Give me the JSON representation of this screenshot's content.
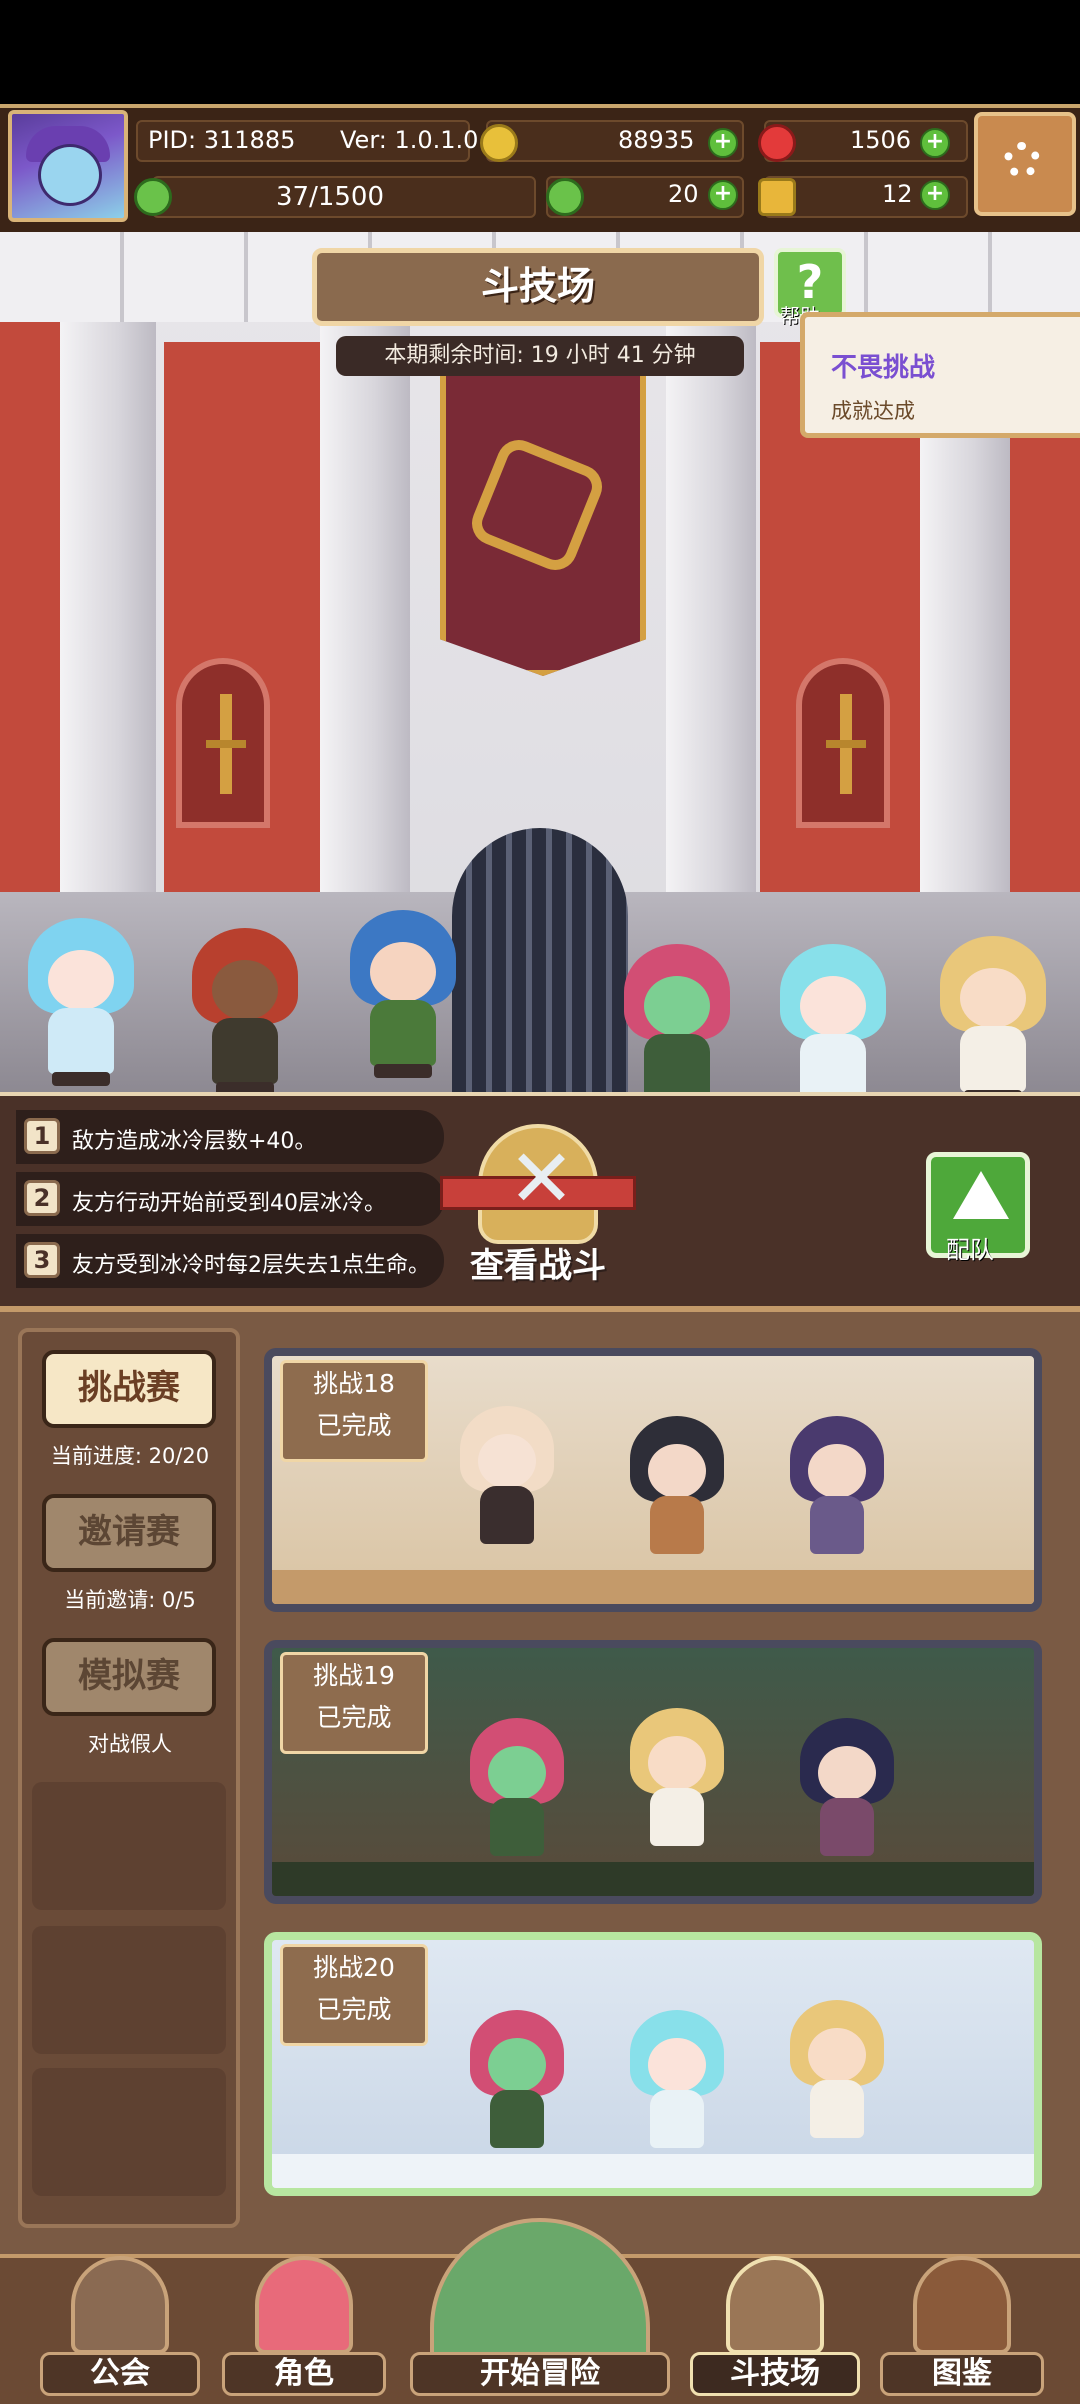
{
  "header": {
    "pid": "PID: 311885",
    "version": "Ver: 1.0.1.0",
    "gold": "88935",
    "gems": "1506",
    "energy": "37/1500",
    "clover": "20",
    "tokens": "12"
  },
  "arena": {
    "title": "斗技场",
    "help_label": "帮助",
    "timer": "本期剩余时间: 19 小时 41 分钟",
    "achievement_title": "不畏挑战",
    "achievement_sub": "成就达成"
  },
  "rules": [
    {
      "num": "1",
      "text": "敌方造成冰冷层数+40。"
    },
    {
      "num": "2",
      "text": "友方行动开始前受到40层冰冷。"
    },
    {
      "num": "3",
      "text": "友方受到冰冷时每2层失去1点生命。"
    }
  ],
  "actions": {
    "view_battle": "查看战斗",
    "team": "配队"
  },
  "sidebar": {
    "challenge": {
      "label": "挑战赛",
      "sub": "当前进度: 20/20"
    },
    "invite": {
      "label": "邀请赛",
      "sub": "当前邀请: 0/5"
    },
    "mock": {
      "label": "模拟赛",
      "sub": "对战假人"
    }
  },
  "cards": [
    {
      "title": "挑战18",
      "status": "已完成"
    },
    {
      "title": "挑战19",
      "status": "已完成"
    },
    {
      "title": "挑战20",
      "status": "已完成"
    }
  ],
  "nav": {
    "guild": "公会",
    "characters": "角色",
    "adventure": "开始冒险",
    "arena": "斗技场",
    "codex": "图鉴"
  },
  "colors": {
    "frame": "#c9a56c",
    "panel": "#4a3128",
    "accent_green": "#4ea83a",
    "achievement_purple": "#7a4fd1"
  }
}
